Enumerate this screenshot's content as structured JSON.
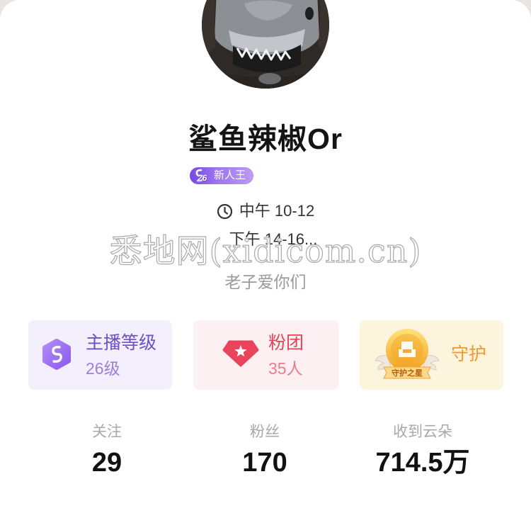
{
  "profile": {
    "name": "鲨鱼辣椒Or",
    "badge": {
      "level": "26",
      "title": "新人王"
    },
    "schedule": {
      "line1": "中午 10-12",
      "line2": "下午 14-16..."
    },
    "bio": "老子爱你们"
  },
  "watermark": "悉地网(xidicom.cn)",
  "cards": [
    {
      "title": "主播等级",
      "value": "26级",
      "icon": "hexagon-music-icon"
    },
    {
      "title": "粉团",
      "value": "35人",
      "icon": "star-gem-icon"
    },
    {
      "title": "守护",
      "badge_text": "守护之星",
      "icon": "guard-star-badge-icon"
    }
  ],
  "stats": [
    {
      "label": "关注",
      "value": "29"
    },
    {
      "label": "粉丝",
      "value": "170"
    },
    {
      "label": "收到云朵",
      "value": "714.5万"
    }
  ],
  "icons": {
    "schedule": "clock-icon",
    "badge": "music-note-icon"
  },
  "colors": {
    "level_card_bg": "#f4effd",
    "level_accent": "#9a6cf2",
    "fans_card_bg": "#fdf0f2",
    "fans_accent": "#e8455d",
    "guard_card_bg": "#fdf4de",
    "guard_accent": "#f09a2c",
    "badge": "#9b72ef"
  }
}
